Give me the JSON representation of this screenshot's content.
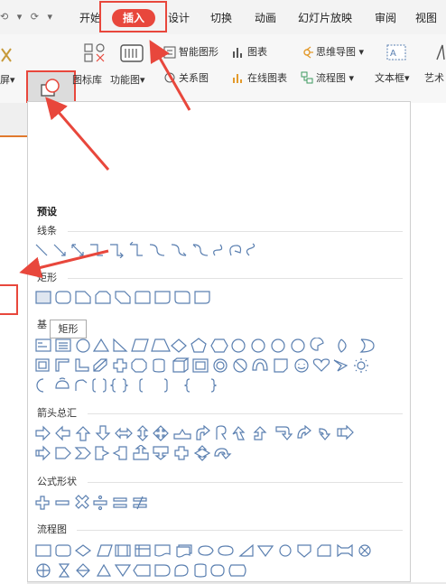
{
  "quick_access": "⟲ ▾  ⟳ ▾",
  "tabs": {
    "start": "开始",
    "insert": "插入",
    "design": "设计",
    "switch": "切换",
    "animation": "动画",
    "slideshow": "幻灯片放映",
    "review": "审阅",
    "view": "视图"
  },
  "ribbon": {
    "screenshot": "屏▾",
    "shape": "形状",
    "icon_lib": "图标库",
    "func_chart": "功能图",
    "smart_art": "智能图形",
    "chart": "图表",
    "mind_map": "思维导图",
    "relation": "关系图",
    "online_chart": "在线图表",
    "flowchart": "流程图",
    "textbox": "文本框",
    "art": "艺术"
  },
  "panel": {
    "preset": "预设",
    "lines": "线条",
    "rect": "矩形",
    "basic": "基",
    "arrows": "箭头总汇",
    "formula": "公式形状",
    "flowchart": "流程图",
    "tooltip": "矩形"
  },
  "colors": {
    "accent": "#e8473c",
    "shape_stroke": "#5a7fb0"
  }
}
